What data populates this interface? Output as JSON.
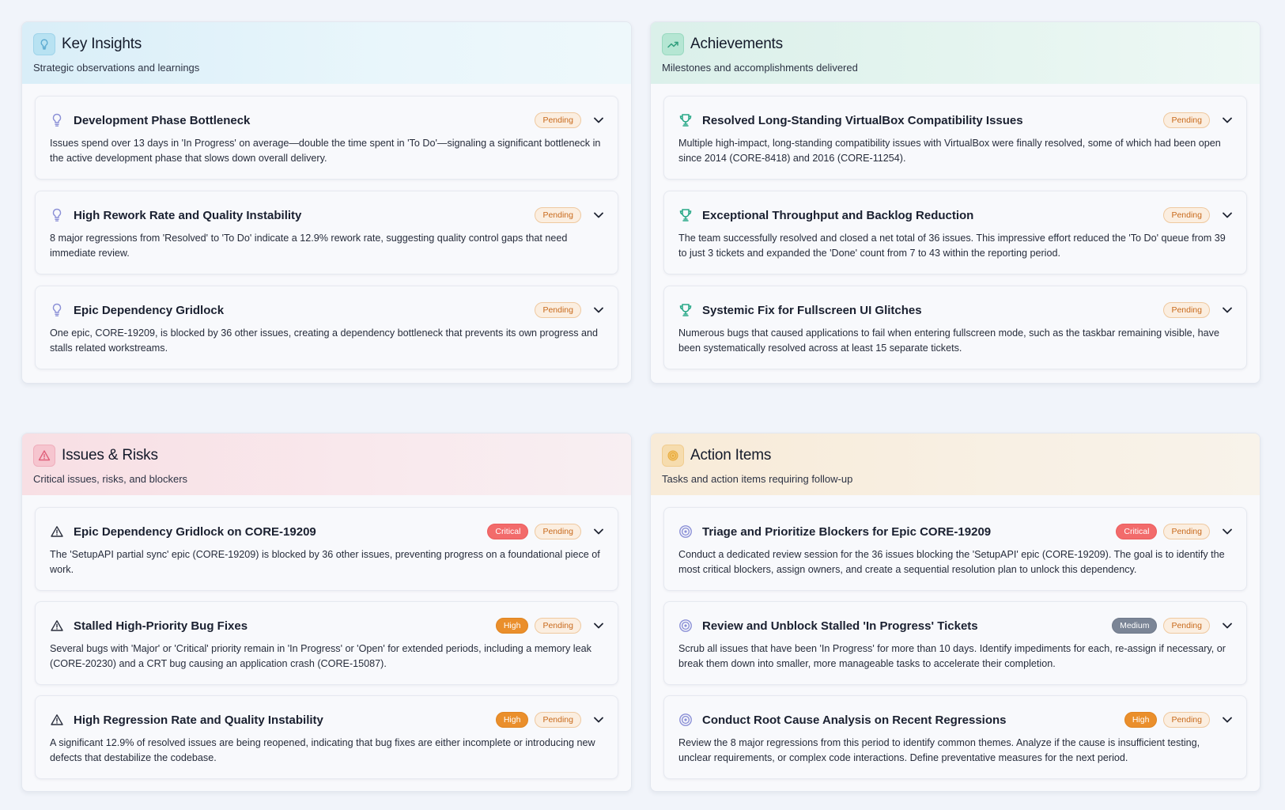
{
  "insights": {
    "title": "Key Insights",
    "subtitle": "Strategic observations and learnings",
    "icon": "lightbulb-icon",
    "items": [
      {
        "title": "Development Phase Bottleneck",
        "status": "Pending",
        "text": "Issues spend over 13 days in 'In Progress' on average—double the time spent in 'To Do'—signaling a significant bottleneck in the active development phase that slows down overall delivery."
      },
      {
        "title": "High Rework Rate and Quality Instability",
        "status": "Pending",
        "text": "8 major regressions from 'Resolved' to 'To Do' indicate a 12.9% rework rate, suggesting quality control gaps that need immediate review."
      },
      {
        "title": "Epic Dependency Gridlock",
        "status": "Pending",
        "text": "One epic, CORE-19209, is blocked by 36 other issues, creating a dependency bottleneck that prevents its own progress and stalls related workstreams."
      }
    ]
  },
  "achievements": {
    "title": "Achievements",
    "subtitle": "Milestones and accomplishments delivered",
    "icon": "trending-up-icon",
    "items": [
      {
        "title": "Resolved Long-Standing VirtualBox Compatibility Issues",
        "status": "Pending",
        "text": "Multiple high-impact, long-standing compatibility issues with VirtualBox were finally resolved, some of which had been open since 2014 (CORE-8418) and 2016 (CORE-11254)."
      },
      {
        "title": "Exceptional Throughput and Backlog Reduction",
        "status": "Pending",
        "text": "The team successfully resolved and closed a net total of 36 issues. This impressive effort reduced the 'To Do' queue from 39 to just 3 tickets and expanded the 'Done' count from 7 to 43 within the reporting period."
      },
      {
        "title": "Systemic Fix for Fullscreen UI Glitches",
        "status": "Pending",
        "text": "Numerous bugs that caused applications to fail when entering fullscreen mode, such as the taskbar remaining visible, have been systematically resolved across at least 15 separate tickets."
      }
    ]
  },
  "issues": {
    "title": "Issues & Risks",
    "subtitle": "Critical issues, risks, and blockers",
    "icon": "warning-icon",
    "items": [
      {
        "title": "Epic Dependency Gridlock on CORE-19209",
        "priority": "Critical",
        "status": "Pending",
        "text": "The 'SetupAPI partial sync' epic (CORE-19209) is blocked by 36 other issues, preventing progress on a foundational piece of work."
      },
      {
        "title": "Stalled High-Priority Bug Fixes",
        "priority": "High",
        "status": "Pending",
        "text": "Several bugs with 'Major' or 'Critical' priority remain in 'In Progress' or 'Open' for extended periods, including a memory leak (CORE-20230) and a CRT bug causing an application crash (CORE-15087)."
      },
      {
        "title": "High Regression Rate and Quality Instability",
        "priority": "High",
        "status": "Pending",
        "text": "A significant 12.9% of resolved issues are being reopened, indicating that bug fixes are either incomplete or introducing new defects that destabilize the codebase."
      }
    ]
  },
  "actions": {
    "title": "Action Items",
    "subtitle": "Tasks and action items requiring follow-up",
    "icon": "target-icon",
    "items": [
      {
        "title": "Triage and Prioritize Blockers for Epic CORE-19209",
        "priority": "Critical",
        "status": "Pending",
        "text": "Conduct a dedicated review session for the 36 issues blocking the 'SetupAPI' epic (CORE-19209). The goal is to identify the most critical blockers, assign owners, and create a sequential resolution plan to unlock this dependency."
      },
      {
        "title": "Review and Unblock Stalled 'In Progress' Tickets",
        "priority": "Medium",
        "status": "Pending",
        "text": "Scrub all issues that have been 'In Progress' for more than 10 days. Identify impediments for each, re-assign if necessary, or break them down into smaller, more manageable tasks to accelerate their completion."
      },
      {
        "title": "Conduct Root Cause Analysis on Recent Regressions",
        "priority": "High",
        "status": "Pending",
        "text": "Review the 8 major regressions from this period to identify common themes. Analyze if the cause is insufficient testing, unclear requirements, or complex code interactions. Define preventative measures for the next period."
      }
    ]
  }
}
